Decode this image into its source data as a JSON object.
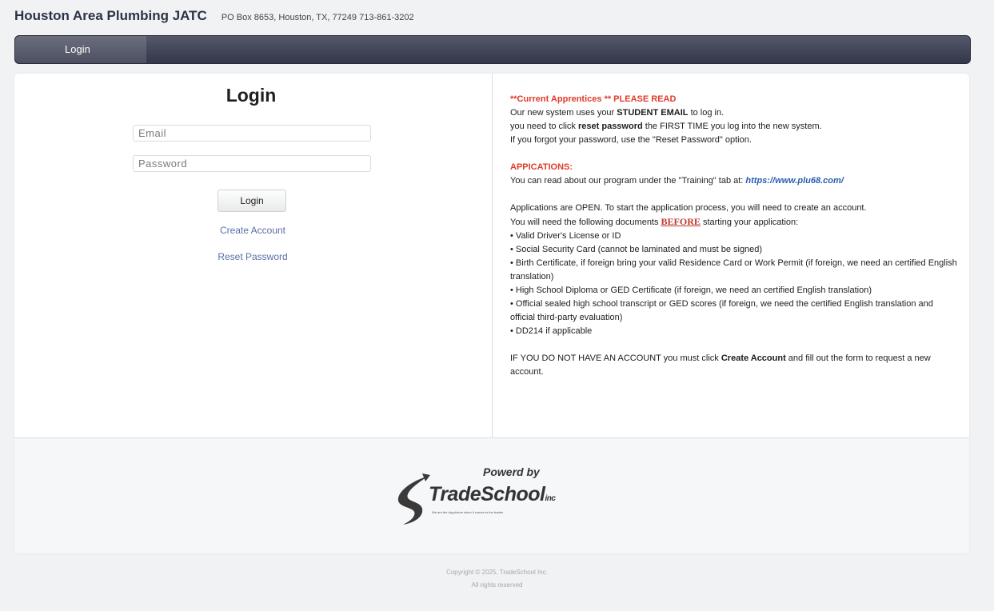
{
  "header": {
    "org_name": "Houston Area Plumbing JATC",
    "contact": "PO Box 8653, Houston, TX, 77249   713-861-3202"
  },
  "nav": {
    "tabs": [
      "Login"
    ]
  },
  "login": {
    "title": "Login",
    "email_placeholder": "Email",
    "password_placeholder": "Password",
    "button_label": "Login",
    "create_account": "Create Account",
    "reset_password": "Reset Password"
  },
  "notice": {
    "current_title": "**Current Apprentices ** PLEASE READ",
    "line1_pre": "Our new system uses your ",
    "line1_bold": "STUDENT EMAIL",
    "line1_post": " to log in.",
    "line2_pre": "you need to click ",
    "line2_bold": "reset password",
    "line2_post": " the FIRST TIME you log into the new system.",
    "line3": "If you forgot your password, use the \"Reset Password\" option.",
    "applications_title": "APPICATIONS:",
    "program_pre": "You can read about our program under the \"Training\" tab at: ",
    "program_url": "https://www.plu68.com/",
    "open_text": "Applications are OPEN. To start the application process, you will need to create an account.",
    "docs_pre": "You will need the following documents ",
    "docs_before": "BEFORE",
    "docs_post": " starting your application:",
    "documents": [
      "• Valid Driver's License or ID",
      "• Social Security Card (cannot be laminated and must be signed)",
      "• Birth Certificate, if foreign bring your valid Residence Card or Work Permit (if foreign, we need an certified English translation)",
      "• High School Diploma or GED Certificate (if foreign, we need an certified English translation)",
      "• Official sealed high school transcript or GED scores (if foreign, we need the certified English translation and official third-party evaluation)",
      "• DD214 if applicable"
    ],
    "no_account_pre": "IF YOU DO NOT HAVE AN ACCOUNT you must click ",
    "no_account_bold": "Create Account",
    "no_account_post": " and fill out the form to request a new account."
  },
  "footer": {
    "powered_by": "Powerd by",
    "logo_main": "TradeSchool",
    "logo_suffix": "inc",
    "logo_tagline": "We are the big picture when it comes to the trades",
    "copyright_line1": "Copyright © 2025, TradeSchool Inc.",
    "copyright_line2": "All rights reserved"
  }
}
